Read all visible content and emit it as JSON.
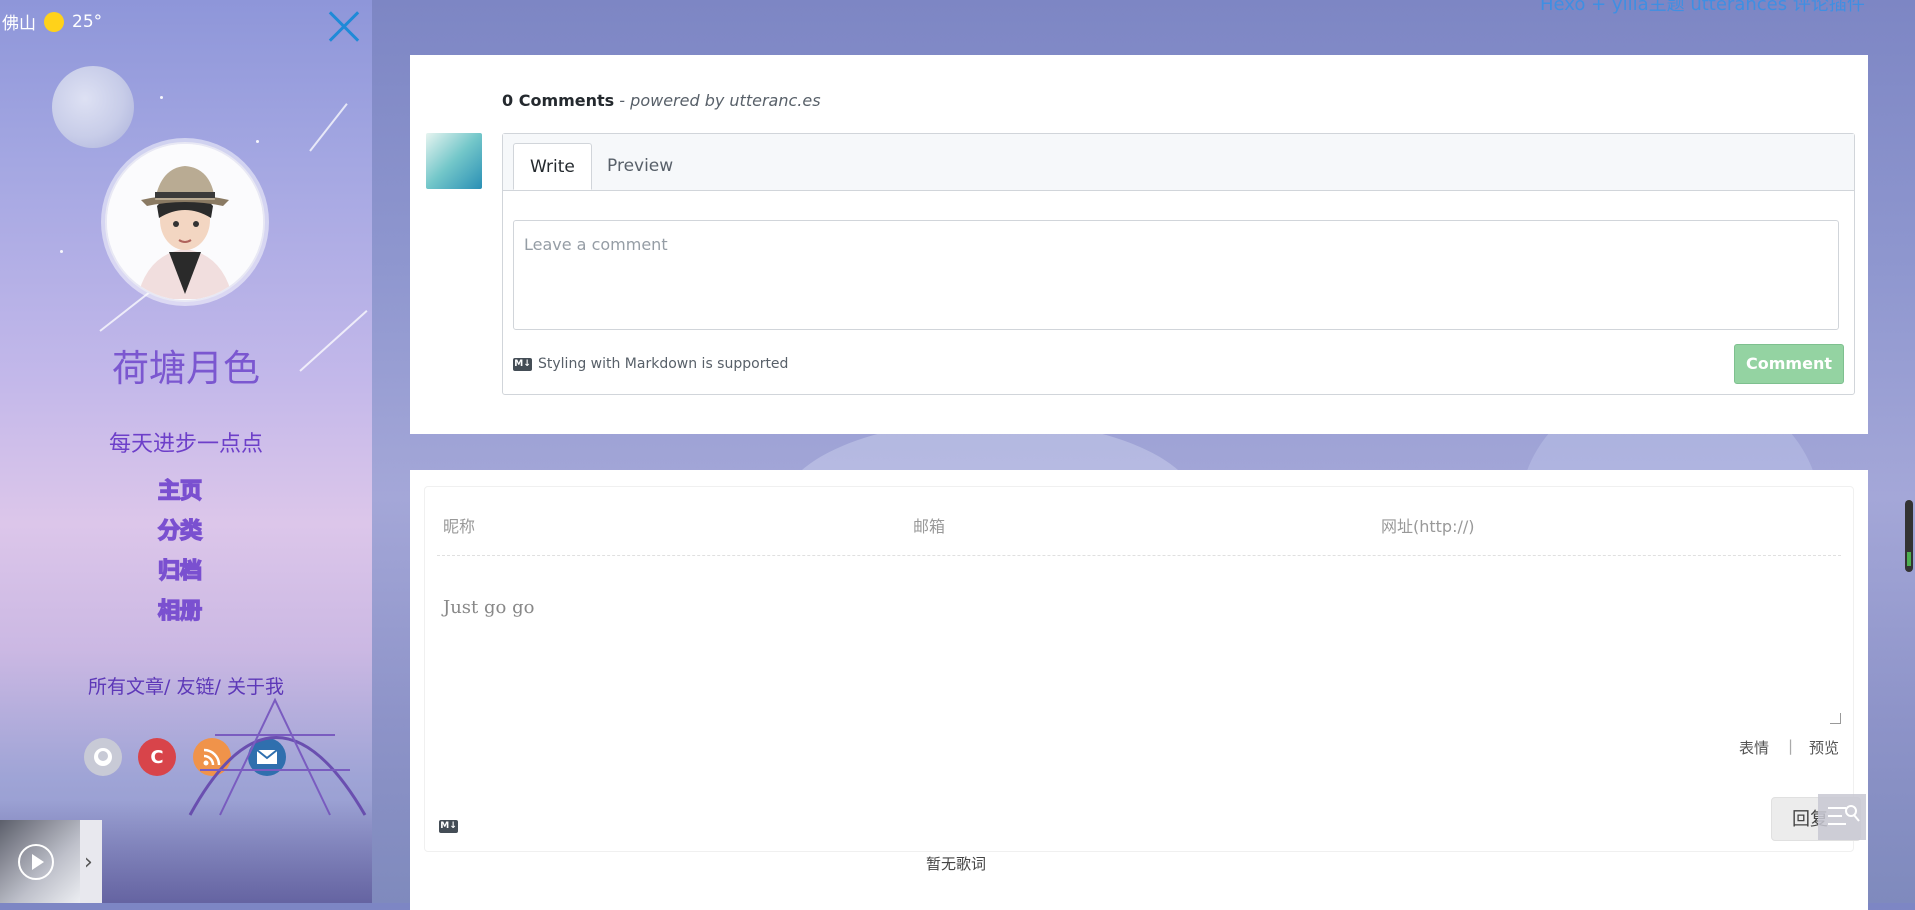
{
  "sidebar": {
    "weather": {
      "city": "佛山",
      "temp": "25°"
    },
    "site_title": "荷塘月色",
    "subtitle": "每天进步一点点",
    "nav": [
      {
        "label": "主页"
      },
      {
        "label": "分类"
      },
      {
        "label": "归档"
      },
      {
        "label": "相册"
      }
    ],
    "links": {
      "all_posts": "所有文章/",
      "friends": "友链/",
      "about": "关于我"
    },
    "social": [
      {
        "icon": "github-icon",
        "glyph": "",
        "color": "#c8cad6"
      },
      {
        "icon": "csdn-icon",
        "glyph": "C",
        "color": "#d8444a"
      },
      {
        "icon": "rss-icon",
        "glyph": "",
        "color": "#f0934a"
      },
      {
        "icon": "email-icon",
        "glyph": "",
        "color": "#2f6fae"
      }
    ]
  },
  "header": {
    "top_link": "Hexo + yilia主题 utterances 评论插件"
  },
  "utterances": {
    "count_label": "0 Comments",
    "powered_by": "- powered by utteranc.es",
    "tabs": [
      {
        "label": "Write"
      },
      {
        "label": "Preview"
      }
    ],
    "placeholder": "Leave a comment",
    "markdown_note": "Styling with Markdown is supported",
    "comment_button": "Comment"
  },
  "valine": {
    "nick_placeholder": "昵称",
    "email_placeholder": "邮箱",
    "url_placeholder": "网址(http://)",
    "text_placeholder": "Just go go",
    "emoji_label": "表情",
    "preview_label": "预览",
    "submit_label": "回复"
  },
  "player": {
    "lyric": "暂无歌词"
  },
  "colors": {
    "accent": "#7b57d0",
    "comment_btn": "#94d3a2",
    "close": "#1f8ad8"
  }
}
